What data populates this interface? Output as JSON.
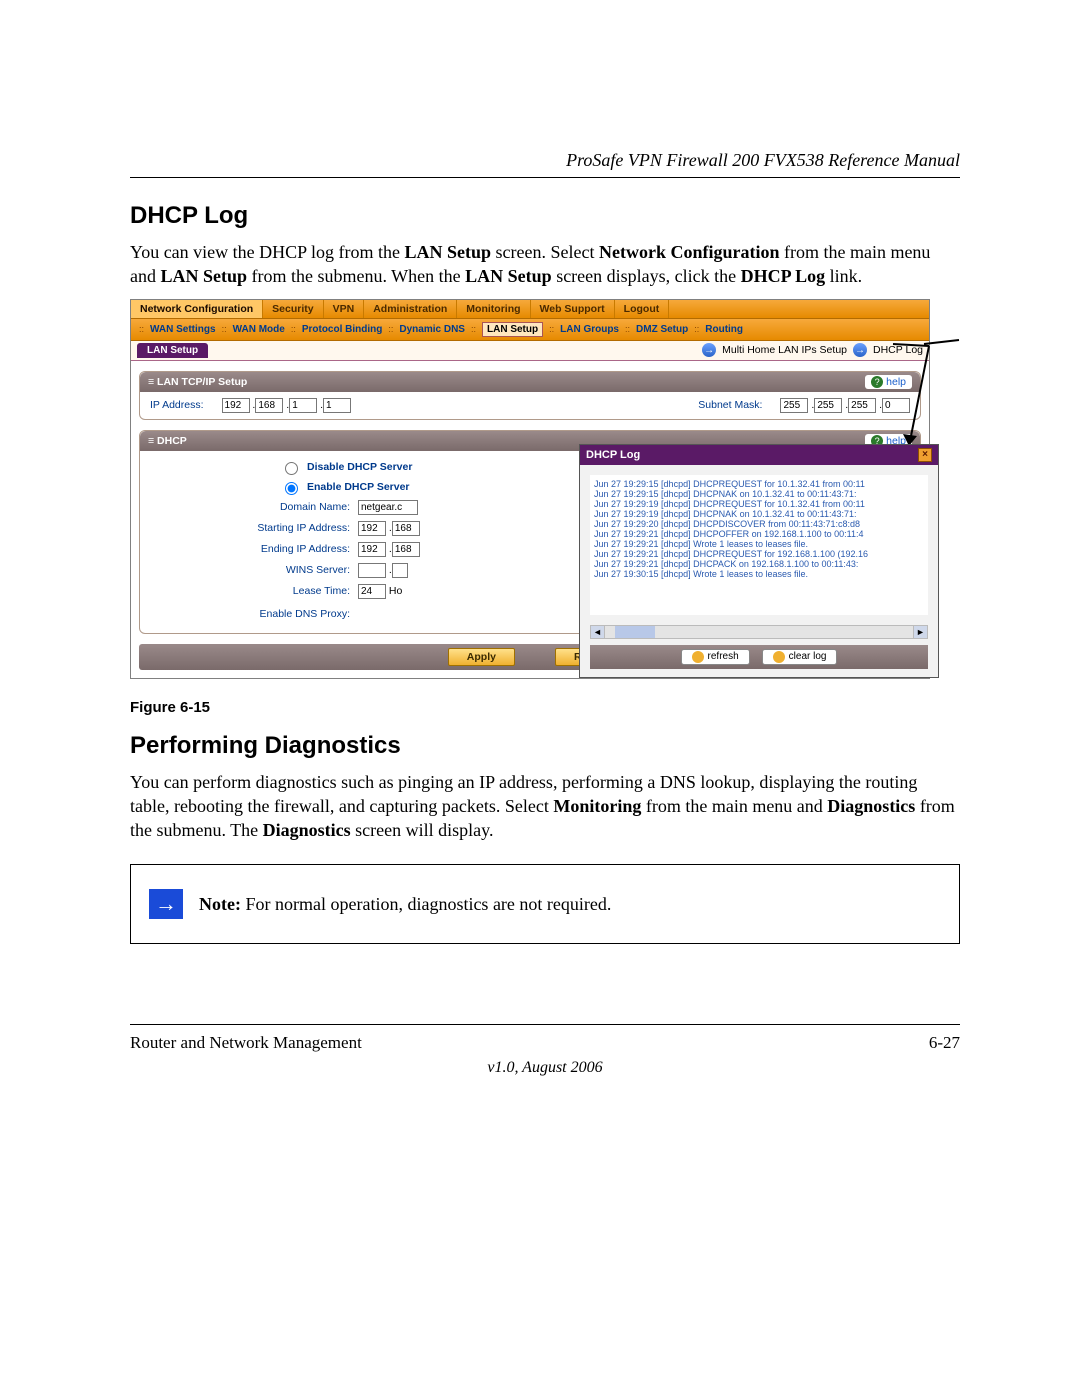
{
  "doc": {
    "header_title": "ProSafe VPN Firewall 200 FVX538 Reference Manual",
    "section1_heading": "DHCP Log",
    "section1_para_pre": "You can view the DHCP log from the ",
    "s1_b1": "LAN Setup",
    "s1_mid1": " screen. Select ",
    "s1_b2": "Network Configuration",
    "s1_mid2": " from the main menu and ",
    "s1_b3": "LAN Setup",
    "s1_mid3": " from the submenu. When the ",
    "s1_b4": "LAN Setup",
    "s1_mid4": " screen displays, click the ",
    "s1_b5": "DHCP Log",
    "s1_mid5": " link.",
    "figure_caption": "Figure 6-15",
    "section2_heading": "Performing Diagnostics",
    "section2_para_pre": "You can perform diagnostics such as pinging an IP address, performing a DNS lookup, displaying the routing table, rebooting the firewall, and capturing packets. Select ",
    "s2_b1": "Monitoring",
    "s2_mid1": " from the main menu and ",
    "s2_b2": "Diagnostics",
    "s2_mid2": " from the submenu. The ",
    "s2_b3": "Diagnostics",
    "s2_mid3": " screen will display.",
    "note_bold": "Note:",
    "note_text": " For normal operation, diagnostics are not required.",
    "footer_left": "Router and Network Management",
    "footer_right": "6-27",
    "footer_version": "v1.0, August 2006"
  },
  "ui": {
    "mainnav": [
      "Network Configuration",
      "Security",
      "VPN",
      "Administration",
      "Monitoring",
      "Web Support",
      "Logout"
    ],
    "submenu": [
      "WAN Settings",
      "WAN Mode",
      "Protocol Binding",
      "Dynamic DNS",
      "LAN Setup",
      "LAN Groups",
      "DMZ Setup",
      "Routing"
    ],
    "lan_tab": "LAN Setup",
    "link_multihome": "Multi Home LAN IPs Setup",
    "link_dhcplog": "DHCP Log",
    "group1_title": "LAN TCP/IP Setup",
    "help": "help",
    "ip_label": "IP Address:",
    "ip": [
      "192",
      "168",
      "1",
      "1"
    ],
    "subnet_label": "Subnet Mask:",
    "subnet": [
      "255",
      "255",
      "255",
      "0"
    ],
    "group2_title": "DHCP",
    "radio_disable": "Disable DHCP Server",
    "radio_enable": "Enable DHCP Server",
    "fields": {
      "domain_label": "Domain Name:",
      "domain_val": "netgear.c",
      "start_label": "Starting IP Address:",
      "start": [
        "192",
        "168"
      ],
      "end_label": "Ending IP Address:",
      "end": [
        "192",
        "168"
      ],
      "wins_label": "WINS Server:",
      "lease_label": "Lease Time:",
      "lease_val": "24",
      "lease_unit": "Ho",
      "dnsproxy_label": "Enable DNS Proxy:"
    },
    "apply": "Apply",
    "reset": "Res",
    "popup_title": "DHCP Log",
    "log": [
      "Jun 27 19:29:15 [dhcpd] DHCPREQUEST for 10.1.32.41 from 00:11",
      "Jun 27 19:29:15 [dhcpd] DHCPNAK on 10.1.32.41 to 00:11:43:71:",
      "Jun 27 19:29:19 [dhcpd] DHCPREQUEST for 10.1.32.41 from 00:11",
      "Jun 27 19:29:19 [dhcpd] DHCPNAK on 10.1.32.41 to 00:11:43:71:",
      "Jun 27 19:29:20 [dhcpd] DHCPDISCOVER from 00:11:43:71:c8:d8",
      "Jun 27 19:29:21 [dhcpd] DHCPOFFER on 192.168.1.100 to 00:11:4",
      "Jun 27 19:29:21 [dhcpd] Wrote 1 leases to leases file.",
      "Jun 27 19:29:21 [dhcpd] DHCPREQUEST for 192.168.1.100 (192.16",
      "Jun 27 19:29:21 [dhcpd] DHCPACK on 192.168.1.100 to 00:11:43:",
      "Jun 27 19:30:15 [dhcpd] Wrote 1 leases to leases file."
    ],
    "refresh": "refresh",
    "clearlog": "clear log"
  }
}
